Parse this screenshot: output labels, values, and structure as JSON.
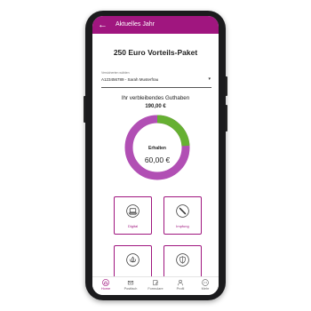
{
  "app": {
    "title": "Aktuelles Jahr"
  },
  "package": {
    "title": "250 Euro Vorteils-Paket"
  },
  "insured": {
    "label": "Versicherten wählen",
    "value": "A123456789 - Sarah Musterfrau"
  },
  "balance": {
    "label": "Ihr verbleibendes Guthaben",
    "value": "190,00 €"
  },
  "donut": {
    "label": "Erhalten",
    "value": "60,00 €",
    "received_amount": 60,
    "total_amount": 250,
    "colors": {
      "received": "#66b032",
      "remaining": "#b14fb4"
    }
  },
  "tiles": [
    {
      "label": "Digital",
      "icon": "laptop-icon"
    },
    {
      "label": "Impfung",
      "icon": "syringe-icon"
    },
    {
      "label": "",
      "icon": "lotus-icon"
    },
    {
      "label": "",
      "icon": "shield-icon"
    }
  ],
  "bottom_nav": [
    {
      "label": "Home",
      "icon": "home-icon",
      "active": true
    },
    {
      "label": "Postfach",
      "icon": "mailbox-icon",
      "active": false
    },
    {
      "label": "Formulare",
      "icon": "form-icon",
      "active": false
    },
    {
      "label": "Profil",
      "icon": "profile-icon",
      "active": false
    },
    {
      "label": "Mehr",
      "icon": "more-icon",
      "active": false
    }
  ],
  "colors": {
    "brand": "#a0167f"
  }
}
